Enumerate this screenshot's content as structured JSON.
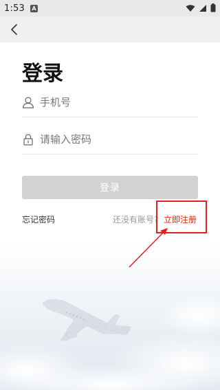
{
  "status_bar": {
    "time": "1:53",
    "notification_badge": "A"
  },
  "header": {
    "back_icon": "chevron-left-icon"
  },
  "title": "登录",
  "phone_field": {
    "placeholder": "手机号",
    "icon": "person-icon"
  },
  "password_field": {
    "placeholder": "请输入密码",
    "icon": "lock-icon"
  },
  "login_button": {
    "label": "登录"
  },
  "links": {
    "forgot_password": "忘记密码",
    "no_account_text": "还没有账号?",
    "register": "立即注册"
  },
  "colors": {
    "accent_red": "#e1251b",
    "button_disabled": "#d2d2d2",
    "header_bg": "#efefef"
  }
}
